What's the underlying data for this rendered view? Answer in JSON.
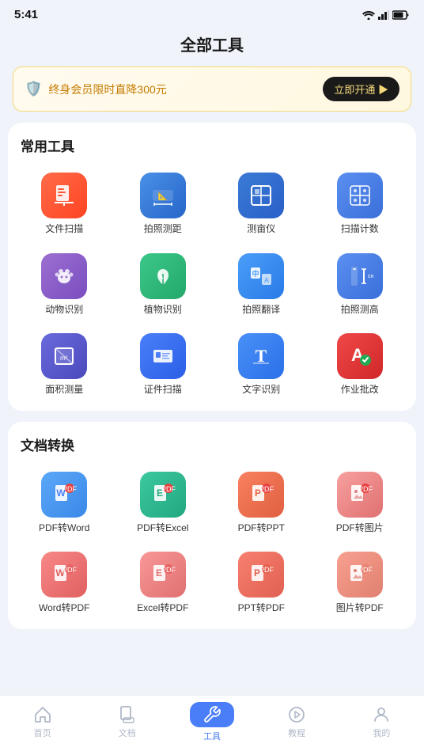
{
  "statusBar": {
    "time": "5:41"
  },
  "header": {
    "title": "全部工具"
  },
  "banner": {
    "text": "终身会员限时直降300元",
    "btnLabel": "立即开通 ▶"
  },
  "commonTools": {
    "sectionTitle": "常用工具",
    "items": [
      {
        "label": "文件扫描",
        "iconClass": "icon-scan-file",
        "symbol": "📄"
      },
      {
        "label": "拍照测距",
        "iconClass": "icon-measure-photo",
        "symbol": "📐"
      },
      {
        "label": "测亩仪",
        "iconClass": "icon-surveyor",
        "symbol": "🗺"
      },
      {
        "label": "扫描计数",
        "iconClass": "icon-scan-count",
        "symbol": "🔢"
      },
      {
        "label": "动物识别",
        "iconClass": "icon-animal",
        "symbol": "🐾"
      },
      {
        "label": "植物识别",
        "iconClass": "icon-plant",
        "symbol": "🌿"
      },
      {
        "label": "拍照翻译",
        "iconClass": "icon-translate",
        "symbol": "🌐"
      },
      {
        "label": "拍照测高",
        "iconClass": "icon-height",
        "symbol": "📏"
      },
      {
        "label": "面积测量",
        "iconClass": "icon-area",
        "symbol": "⬜"
      },
      {
        "label": "证件扫描",
        "iconClass": "icon-id-scan",
        "symbol": "🪪"
      },
      {
        "label": "文字识别",
        "iconClass": "icon-text-recog",
        "symbol": "T"
      },
      {
        "label": "作业批改",
        "iconClass": "icon-homework",
        "symbol": "A"
      }
    ]
  },
  "docConvert": {
    "sectionTitle": "文档转换",
    "items": [
      {
        "label": "PDF转Word",
        "iconClass": "icon-pdf-word",
        "symbol": "W"
      },
      {
        "label": "PDF转Excel",
        "iconClass": "icon-pdf-excel",
        "symbol": "E"
      },
      {
        "label": "PDF转PPT",
        "iconClass": "icon-pdf-ppt",
        "symbol": "P"
      },
      {
        "label": "PDF转图片",
        "iconClass": "icon-pdf-img",
        "symbol": "🖼"
      },
      {
        "label": "Word转PDF",
        "iconClass": "icon-pdf2",
        "symbol": "W"
      },
      {
        "label": "Excel转PDF",
        "iconClass": "icon-pdf3",
        "symbol": "E"
      },
      {
        "label": "PPT转PDF",
        "iconClass": "icon-pdf4",
        "symbol": "P"
      },
      {
        "label": "图片转PDF",
        "iconClass": "icon-pdf5",
        "symbol": "🖼"
      }
    ]
  },
  "bottomNav": {
    "items": [
      {
        "label": "首页",
        "active": false
      },
      {
        "label": "文档",
        "active": false
      },
      {
        "label": "工具",
        "active": true
      },
      {
        "label": "教程",
        "active": false
      },
      {
        "label": "我的",
        "active": false
      }
    ]
  }
}
